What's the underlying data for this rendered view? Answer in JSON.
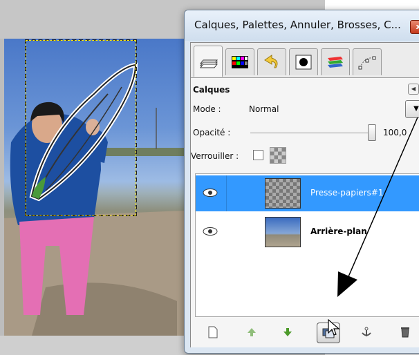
{
  "dialog": {
    "title": "Calques, Palettes, Annuler, Brosses, C...",
    "close_label": "x",
    "tabs": [
      {
        "icon": "layers-icon",
        "active": true
      },
      {
        "icon": "palette-icon"
      },
      {
        "icon": "undo-history-icon"
      },
      {
        "icon": "brush-icon"
      },
      {
        "icon": "gradient-icon"
      },
      {
        "icon": "paths-icon"
      }
    ]
  },
  "layers_panel": {
    "title": "Calques",
    "mode_label": "Mode :",
    "mode_value": "Normal",
    "opacity_label": "Opacité :",
    "opacity_value": "100,0",
    "lock_label": "Verrouiller :",
    "layers": [
      {
        "name": "Presse-papiers#1",
        "selected": true,
        "visible": true
      },
      {
        "name": "Arrière-plan",
        "selected": false,
        "visible": true
      }
    ],
    "toolbar": [
      "new-layer-icon",
      "raise-layer-icon",
      "lower-layer-icon",
      "duplicate-layer-icon",
      "anchor-layer-icon",
      "delete-layer-icon"
    ]
  },
  "colors": {
    "selection_highlight": "#3399ff",
    "raise_arrow": "#4c9a2a",
    "lower_arrow": "#4c9a2a"
  }
}
